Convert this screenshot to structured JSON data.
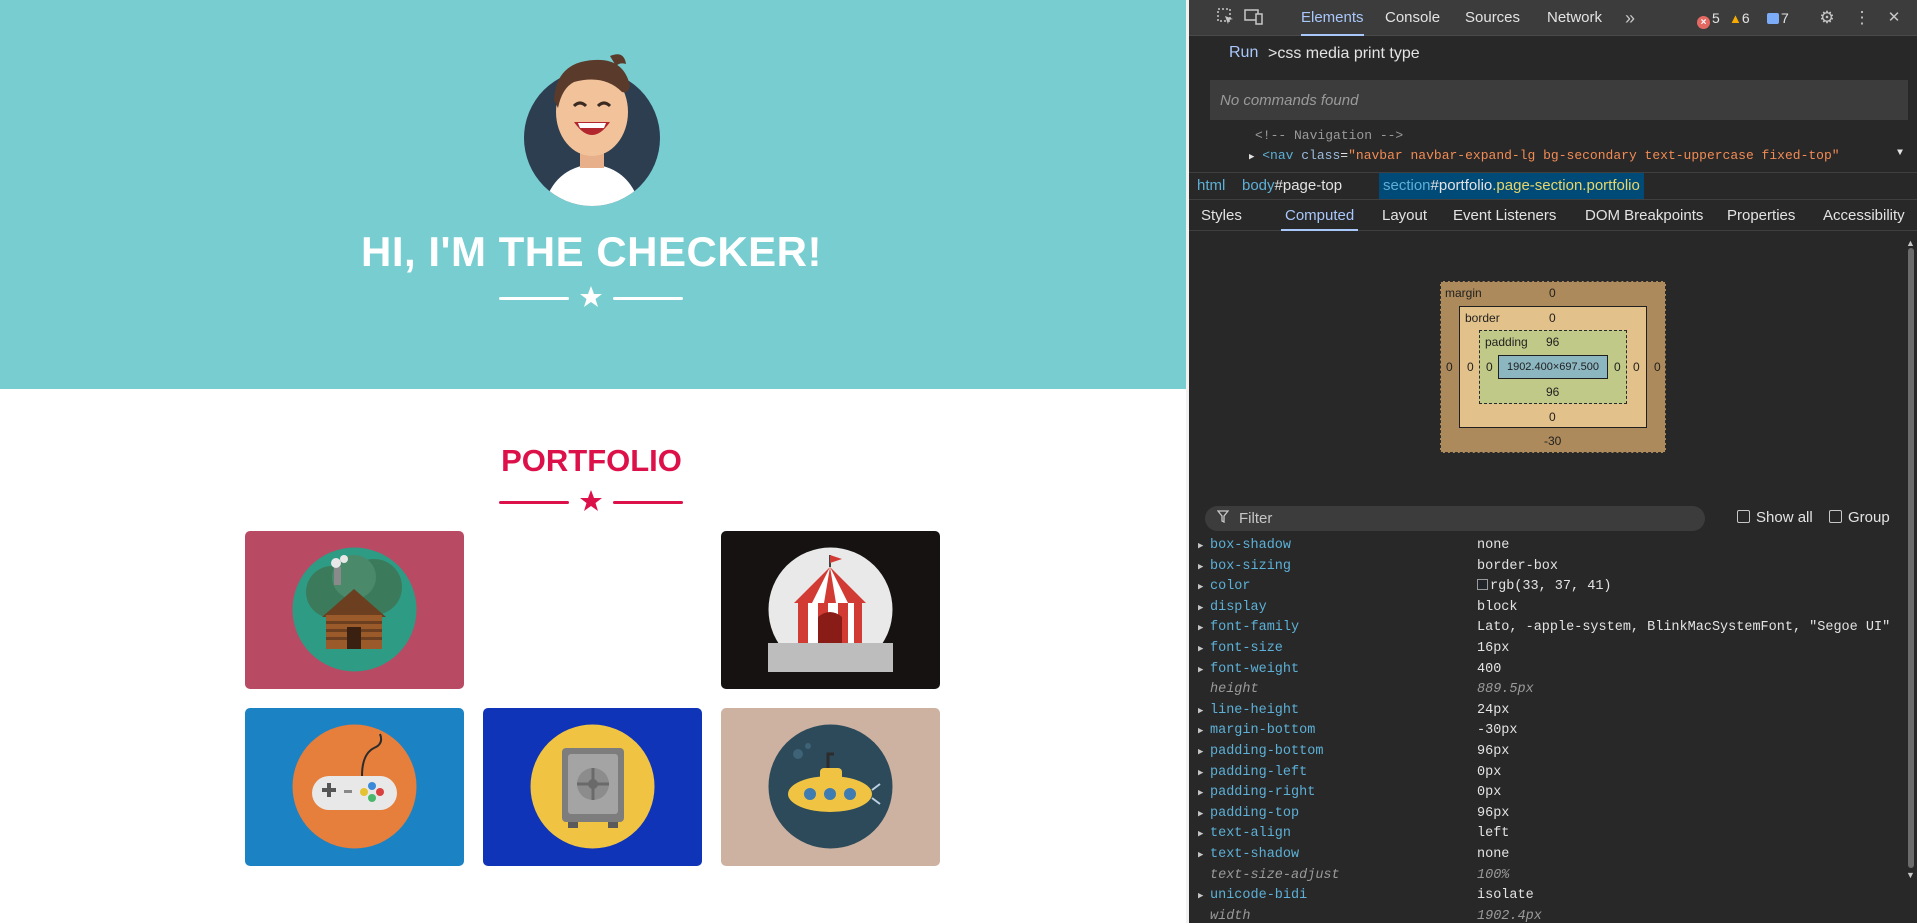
{
  "page": {
    "hero_title": "HI, I'M THE CHECKER!",
    "portfolio_title": "PORTFOLIO",
    "colors": {
      "masthead_bg": "#78cdd1",
      "accent": "#dd1149",
      "divider_light": "#ffffff"
    },
    "tiles": [
      {
        "name": "cabin",
        "bg": "#b94a63",
        "icon": "cabin-icon"
      },
      {
        "name": "circus",
        "bg": "#161212",
        "icon": "circus-tent-icon"
      },
      {
        "name": "game",
        "bg": "#1b82c4",
        "icon": "game-controller-icon"
      },
      {
        "name": "safe",
        "bg": "#0f34b8",
        "icon": "safe-icon"
      },
      {
        "name": "submarine",
        "bg": "#cdb2a2",
        "icon": "submarine-icon"
      }
    ]
  },
  "devtools": {
    "tabs": [
      "Elements",
      "Console",
      "Sources",
      "Network"
    ],
    "more_tabs_icon": "double-chevron-icon",
    "errors": "5",
    "warnings": "6",
    "messages": "7",
    "command": {
      "run_label": "Run",
      "input_value": ">css media print type",
      "no_results": "No commands found"
    },
    "dom": {
      "comment": "<!-- Navigation -->",
      "nav_tag_open": "<nav",
      "nav_attr": "class",
      "nav_class": "\"navbar navbar-expand-lg bg-secondary text-uppercase fixed-top\""
    },
    "breadcrumbs": {
      "html": "html",
      "body_tag": "body",
      "body_id": "#page-top",
      "section_tag": "section",
      "section_id": "#portfolio",
      "section_classes": ".page-section.portfolio"
    },
    "subtabs": [
      "Styles",
      "Computed",
      "Layout",
      "Event Listeners",
      "DOM Breakpoints",
      "Properties",
      "Accessibility"
    ],
    "box_model": {
      "margin_label": "margin",
      "margin_top": "0",
      "margin_right": "0",
      "margin_bottom": "-30",
      "margin_left": "0",
      "border_label": "border",
      "border_top": "0",
      "border_right": "0",
      "border_bottom": "0",
      "border_left": "0",
      "padding_label": "padding",
      "padding_top": "96",
      "padding_right": "0",
      "padding_bottom": "96",
      "padding_left": "0",
      "content": "1902.400×697.500"
    },
    "filter": {
      "placeholder": "Filter",
      "show_all": "Show all",
      "group": "Group"
    },
    "computed": [
      {
        "name": "box-shadow",
        "value": "none",
        "expandable": true
      },
      {
        "name": "box-sizing",
        "value": "border-box",
        "expandable": true
      },
      {
        "name": "color",
        "value": "rgb(33, 37, 41)",
        "expandable": true,
        "swatch": "#212529"
      },
      {
        "name": "display",
        "value": "block",
        "expandable": true
      },
      {
        "name": "font-family",
        "value": "Lato, -apple-system, BlinkMacSystemFont, \"Segoe UI\"",
        "expandable": true
      },
      {
        "name": "font-size",
        "value": "16px",
        "expandable": true
      },
      {
        "name": "font-weight",
        "value": "400",
        "expandable": true
      },
      {
        "name": "height",
        "value": "889.5px",
        "expandable": false
      },
      {
        "name": "line-height",
        "value": "24px",
        "expandable": true
      },
      {
        "name": "margin-bottom",
        "value": "-30px",
        "expandable": true
      },
      {
        "name": "padding-bottom",
        "value": "96px",
        "expandable": true
      },
      {
        "name": "padding-left",
        "value": "0px",
        "expandable": true
      },
      {
        "name": "padding-right",
        "value": "0px",
        "expandable": true
      },
      {
        "name": "padding-top",
        "value": "96px",
        "expandable": true
      },
      {
        "name": "text-align",
        "value": "left",
        "expandable": true
      },
      {
        "name": "text-shadow",
        "value": "none",
        "expandable": true
      },
      {
        "name": "text-size-adjust",
        "value": "100%",
        "expandable": false
      },
      {
        "name": "unicode-bidi",
        "value": "isolate",
        "expandable": true
      },
      {
        "name": "width",
        "value": "1902.4px",
        "expandable": false
      }
    ]
  }
}
